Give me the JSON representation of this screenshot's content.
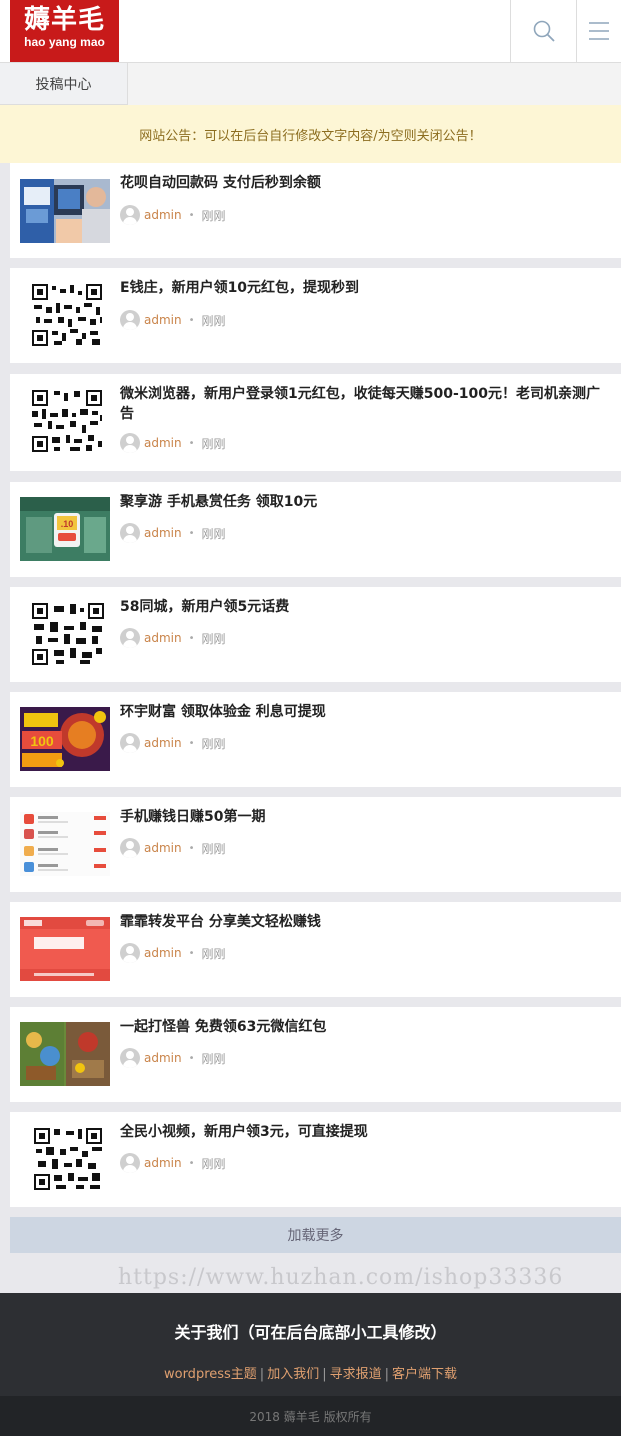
{
  "header": {
    "logo_text": "薅羊毛",
    "logo_sub": "hao yang mao",
    "search_icon": "search-icon",
    "menu_icon": "menu-icon"
  },
  "subnav": {
    "tab": "投稿中心"
  },
  "notice": "网站公告：可以在后台自行修改文字内容/为空则关闭公告！",
  "colors": {
    "logo_red": "#c81a1a",
    "author": "#c9844a",
    "notice_bg": "#fdf6d5",
    "footer_bg": "#2d2f33"
  },
  "posts": [
    {
      "title": "花呗自动回款码 支付后秒到余额",
      "author": "admin",
      "time": "刚刚",
      "thumb": "photo-thumbnail"
    },
    {
      "title": "E钱庄，新用户领10元红包，提现秒到",
      "author": "admin",
      "time": "刚刚",
      "thumb": "qr-code-thumbnail"
    },
    {
      "title": "微米浏览器，新用户登录领1元红包，收徒每天赚500-100元！老司机亲测广告",
      "author": "admin",
      "time": "刚刚",
      "thumb": "qr-code-thumbnail"
    },
    {
      "title": "聚享游 手机悬赏任务 领取10元",
      "author": "admin",
      "time": "刚刚",
      "thumb": "app-screenshot-thumbnail"
    },
    {
      "title": "58同城，新用户领5元话费",
      "author": "admin",
      "time": "刚刚",
      "thumb": "qr-code-thumbnail"
    },
    {
      "title": "环宇财富 领取体验金 利息可提现",
      "author": "admin",
      "time": "刚刚",
      "thumb": "promo-banner-thumbnail"
    },
    {
      "title": "手机赚钱日赚50第一期",
      "author": "admin",
      "time": "刚刚",
      "thumb": "app-list-thumbnail"
    },
    {
      "title": "霏霏转发平台 分享美文轻松赚钱",
      "author": "admin",
      "time": "刚刚",
      "thumb": "red-promo-thumbnail"
    },
    {
      "title": "一起打怪兽 免费领63元微信红包",
      "author": "admin",
      "time": "刚刚",
      "thumb": "game-thumbnail"
    },
    {
      "title": "全民小视频，新用户领3元，可直接提现",
      "author": "admin",
      "time": "刚刚",
      "thumb": "qr-code-thumbnail"
    }
  ],
  "load_more": "加载更多",
  "watermark": "https://www.huzhan.com/ishop33336",
  "footer": {
    "title": "关于我们（可在后台底部小工具修改）",
    "links": [
      "wordpress主题",
      "加入我们",
      "寻求报道",
      "客户端下载"
    ],
    "copyright": "2018 薅羊毛 版权所有"
  }
}
